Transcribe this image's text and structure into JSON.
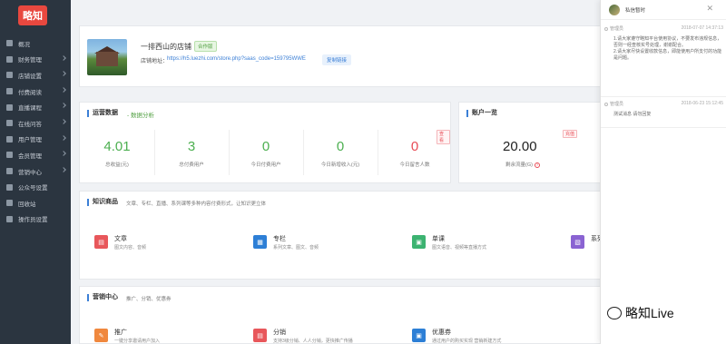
{
  "brand": {
    "logo_text": "略知"
  },
  "sidebar": {
    "items": [
      {
        "label": "概况",
        "icon": "home-icon",
        "expandable": false
      },
      {
        "label": "财务管理",
        "icon": "finance-icon",
        "expandable": true
      },
      {
        "label": "店铺设置",
        "icon": "store-settings-icon",
        "expandable": true
      },
      {
        "label": "付费阅读",
        "icon": "paid-reading-icon",
        "expandable": true
      },
      {
        "label": "直播课程",
        "icon": "live-course-icon",
        "expandable": true
      },
      {
        "label": "在线问答",
        "icon": "qa-icon",
        "expandable": true
      },
      {
        "label": "用户管理",
        "icon": "users-icon",
        "expandable": true
      },
      {
        "label": "会员管理",
        "icon": "members-icon",
        "expandable": true
      },
      {
        "label": "营销中心",
        "icon": "marketing-icon",
        "expandable": true
      },
      {
        "label": "公众号设置",
        "icon": "wechat-icon",
        "expandable": false
      },
      {
        "label": "回收站",
        "icon": "trash-icon",
        "expandable": false
      },
      {
        "label": "操作员设置",
        "icon": "operator-icon",
        "expandable": false
      }
    ]
  },
  "shop": {
    "name": "一排西山的店铺",
    "badge": "合作版",
    "address_label": "店铺地址：",
    "address_url": "https://h5.luezhi.com/store.php?saas_code=159795WWE",
    "copy_label": "复制链接"
  },
  "operations": {
    "title": "运营数据",
    "subtitle": "- 数据分析",
    "stats": [
      {
        "value": "4.01",
        "label": "总收益(元)"
      },
      {
        "value": "3",
        "label": "总付费用户"
      },
      {
        "value": "0",
        "label": "今日付费用户"
      },
      {
        "value": "0",
        "label": "今日新增收入(元)"
      },
      {
        "value": "0",
        "label": "今日留言人数",
        "tag": "查看"
      }
    ]
  },
  "account": {
    "title": "账户一览",
    "tag": "充值",
    "value": "20.00",
    "label": "剩余流量(G)"
  },
  "knowledge": {
    "title": "知识商品",
    "description": "文章、专栏、直播、系列课等多种内容付费形式，让知识更立体",
    "items": [
      {
        "title": "文章",
        "desc": "图文内容、音频",
        "icon": "article-icon",
        "color": "#e8575b"
      },
      {
        "title": "专栏",
        "desc": "系列文章、图文、音频",
        "icon": "column-icon",
        "color": "#2d7fd6"
      },
      {
        "title": "单课",
        "desc": "图文语音、视频等直播方式",
        "icon": "single-course-icon",
        "color": "#3cb371"
      },
      {
        "title": "系列",
        "desc": "",
        "icon": "series-icon",
        "color": "#8a63d2"
      }
    ]
  },
  "marketing": {
    "title": "营销中心",
    "description": "推广、分销、优惠券",
    "items": [
      {
        "title": "推广",
        "desc": "一键分享邀请用户加入",
        "icon": "promote-icon",
        "color": "#f0883e"
      },
      {
        "title": "分销",
        "desc": "支持3级分销、人人分销，更快推广传播",
        "icon": "distribution-icon",
        "color": "#e8575b"
      },
      {
        "title": "优惠券",
        "desc": "通过用户的购买实现 营销新建方式",
        "icon": "coupon-icon",
        "color": "#2d7fd6"
      }
    ]
  },
  "notifications": {
    "name": "私信暂时",
    "messages": [
      {
        "from": "管理员",
        "time": "2018-07-07 14:37:13",
        "body": "1.请大家遵守略知平台使用协议，不要发布违规信息，否则一经查核实号处理，谢谢配合。\n2.请大家尽快设置收款信息，即能使用户所支付的功能是问题。"
      },
      {
        "from": "管理员",
        "time": "2018-06-23 15:12:45",
        "body": "测试消息 请勿回复"
      }
    ]
  },
  "watermark": {
    "text": "略知Live"
  }
}
